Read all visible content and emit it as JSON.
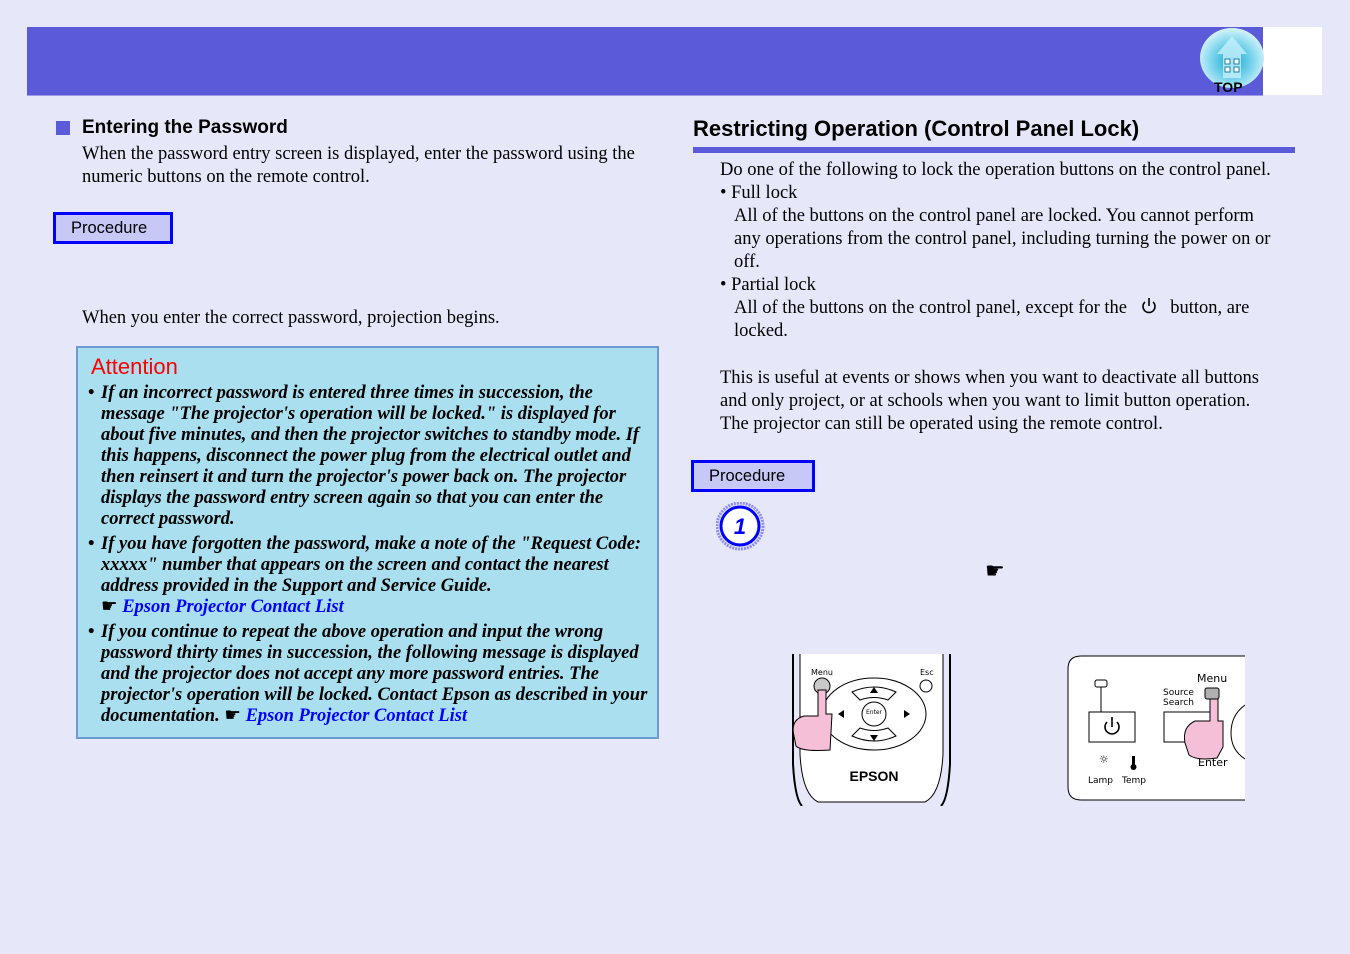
{
  "header": {
    "top_button_label": "TOP",
    "accent_color": "#5b5bd9"
  },
  "left": {
    "section_title": "Entering the Password",
    "intro_line1": "When the password entry screen is displayed, enter the password using the",
    "intro_line2": "numeric buttons on the remote control.",
    "procedure_label": "Procedure",
    "result_text": "When you enter the correct password, projection begins.",
    "attention": {
      "title": "Attention",
      "items": [
        {
          "text": "If an incorrect password is entered three times in succession, the message \"The projector's operation will be locked.\" is displayed for about five minutes, and then the projector switches to standby mode. If this happens, disconnect the power plug from the electrical outlet and then reinsert it and turn the projector's power back on. The projector displays the password entry screen again so that you can enter the correct password."
        },
        {
          "text": "If you have forgotten the password, make a note of the \"Request Code: xxxxx\" number that appears on the screen and contact the nearest address provided in the Support and Service Guide.",
          "link": "Epson Projector Contact List"
        },
        {
          "text": "If you continue to repeat the above operation and input the wrong password thirty times in succession, the following message is displayed and the projector does not accept any more password entries. The projector's operation will be locked. Contact Epson as described in your documentation.",
          "link": "Epson Projector Contact List"
        }
      ]
    }
  },
  "right": {
    "section_title": "Restricting Operation (Control Panel Lock)",
    "intro": "Do one of the following to lock the operation buttons on the control panel.",
    "options": [
      {
        "label": "Full lock",
        "desc_line1": "All of the buttons on the control panel are locked. You cannot perform",
        "desc_line2": "any operations from the control panel, including turning the power on or",
        "desc_line3": "off."
      },
      {
        "label": "Partial lock",
        "desc_before": "All of the buttons on the control panel, except for the",
        "desc_after": "button, are",
        "desc_line2": "locked."
      }
    ],
    "usage_line1": "This is useful at events or shows when you want to deactivate all buttons",
    "usage_line2": "and only project, or at schools when you want to limit button operation.",
    "usage_line3": "The projector can still be operated using the remote control.",
    "procedure_label": "Procedure",
    "step_number": "1",
    "pointer_glyph": "☛",
    "remote_illustration": {
      "menu_label": "Menu",
      "esc_label": "Esc",
      "enter_label": "Enter",
      "brand": "EPSON"
    },
    "panel_illustration": {
      "menu_label": "Menu",
      "source_label_1": "Source",
      "source_label_2": "Search",
      "enter_label": "Enter",
      "lamp_label": "Lamp",
      "temp_label": "Temp"
    }
  }
}
